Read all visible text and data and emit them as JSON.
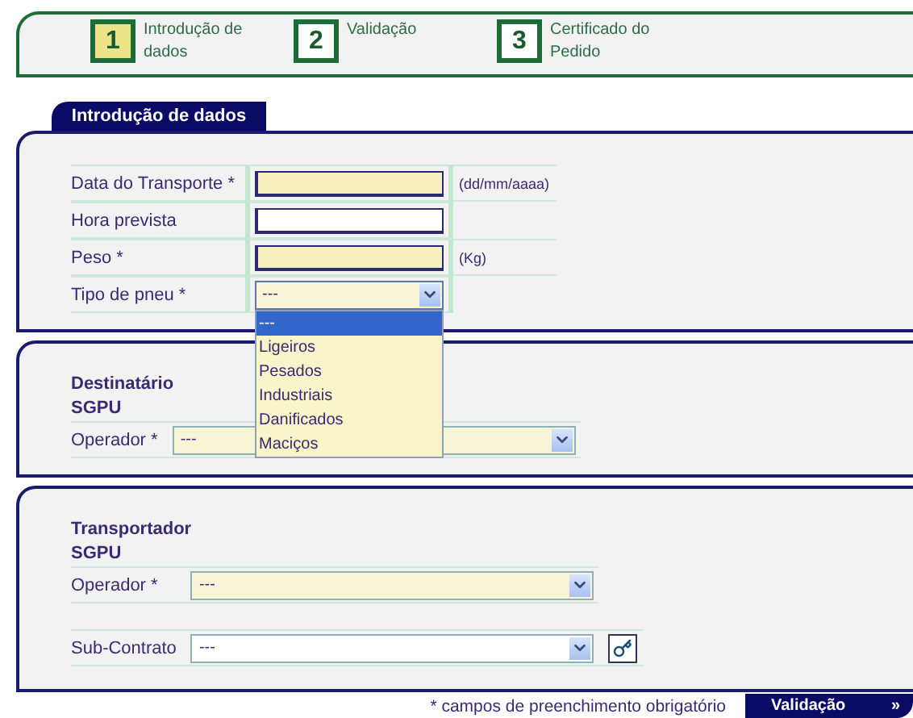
{
  "steps": [
    {
      "number": "1",
      "label": "Introdução de dados",
      "selected": true
    },
    {
      "number": "2",
      "label": "Validação",
      "selected": false
    },
    {
      "number": "3",
      "label": "Certificado do Pedido",
      "selected": false
    }
  ],
  "tab": {
    "label": "Introdução de dados"
  },
  "transport": {
    "fields": [
      {
        "kind": "text",
        "label": "Data do Transporte *",
        "required": true,
        "hint": "(dd/mm/aaaa)"
      },
      {
        "kind": "text",
        "label": "Hora prevista",
        "required": false
      },
      {
        "kind": "text",
        "label": "Peso *",
        "required": true,
        "hint": "(Kg)"
      },
      {
        "kind": "select",
        "label": "Tipo de pneu *",
        "required": true,
        "value": "---",
        "expanded": true,
        "options": [
          {
            "label": "---",
            "selected": true
          },
          {
            "label": "Ligeiros",
            "selected": false
          },
          {
            "label": "Pesados",
            "selected": false
          },
          {
            "label": "Industriais",
            "selected": false
          },
          {
            "label": "Danificados",
            "selected": false
          },
          {
            "label": "Maciços",
            "selected": false
          }
        ]
      }
    ]
  },
  "destinatario": {
    "heading": "Destinatário",
    "subheading": "SGPU",
    "fields": [
      {
        "kind": "select",
        "label": "Operador *",
        "required": true,
        "value": "---"
      }
    ]
  },
  "transportador": {
    "heading": "Transportador",
    "subheading": "SGPU",
    "fields": [
      {
        "kind": "select",
        "label": "Operador *",
        "required": true,
        "value": "---"
      },
      {
        "kind": "select",
        "label": "Sub-Contrato",
        "required": false,
        "value": "---",
        "lookup": true
      }
    ]
  },
  "footer": {
    "note": "* campos de preenchimento obrigatório",
    "next_button": {
      "label": "Validação",
      "glyph": "»"
    }
  }
}
